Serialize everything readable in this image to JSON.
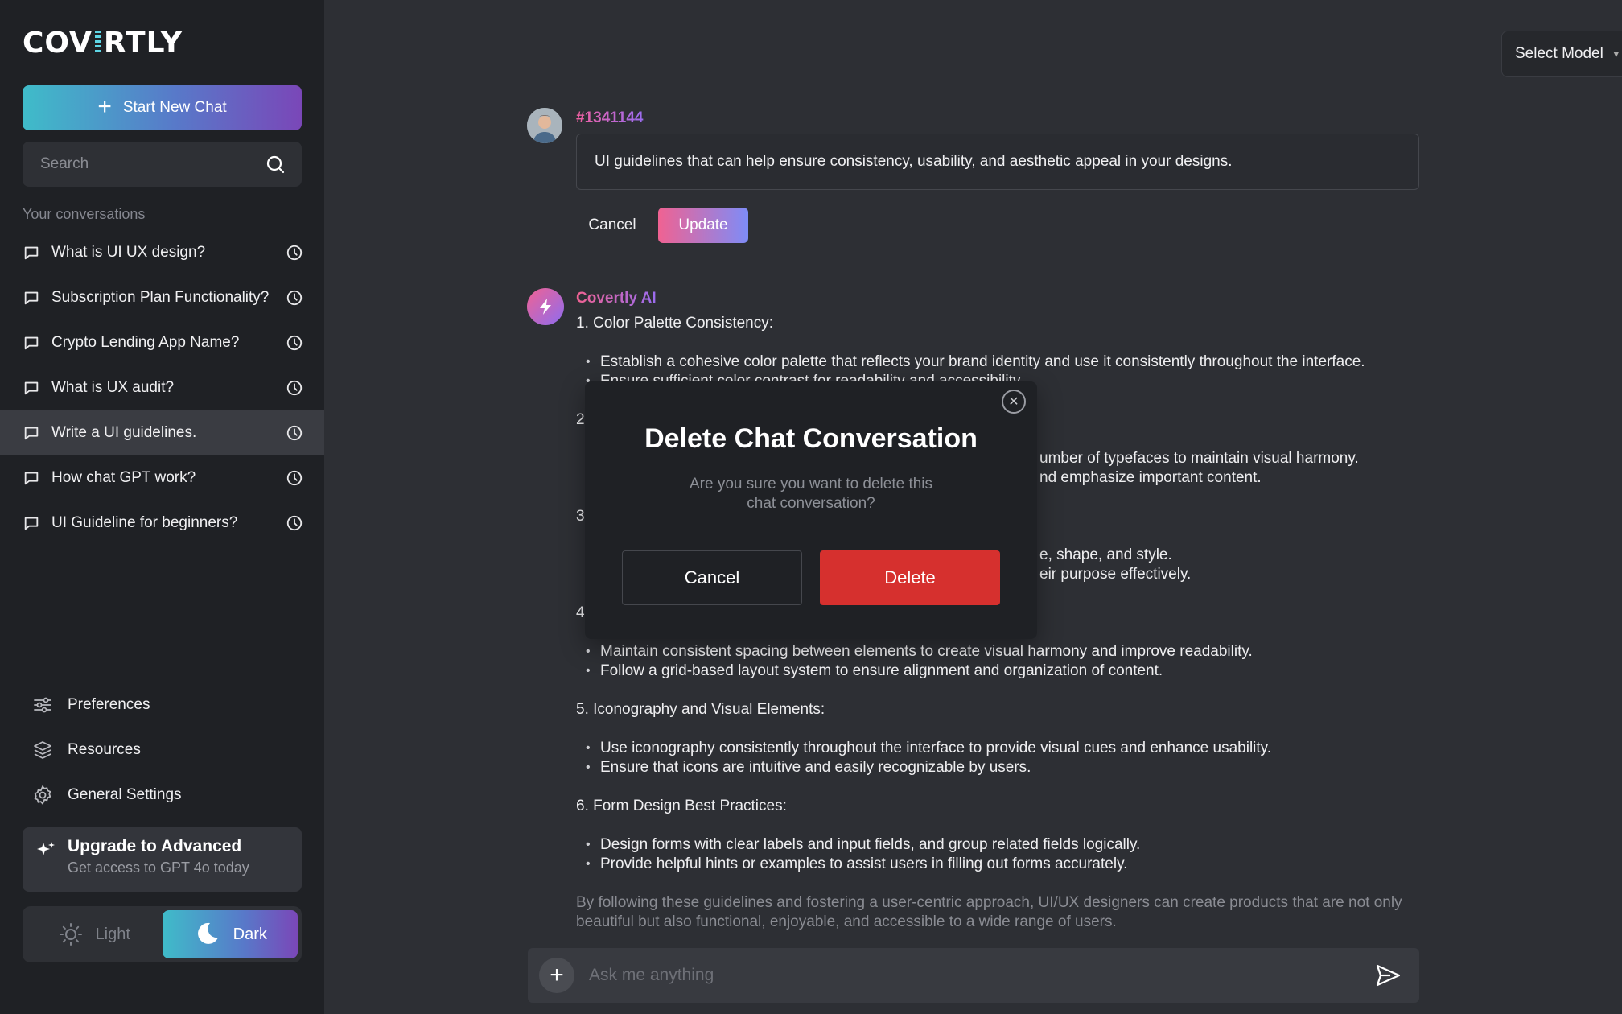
{
  "app": {
    "logo_text_a": "COV",
    "logo_text_b": "RTLY"
  },
  "sidebar": {
    "new_chat_label": "Start New Chat",
    "search_placeholder": "Search",
    "conversations_heading": "Your conversations",
    "conversations": [
      {
        "label": "What is UI UX design?",
        "active": false
      },
      {
        "label": "Subscription Plan Functionality?",
        "active": false
      },
      {
        "label": "Crypto Lending App Name?",
        "active": false
      },
      {
        "label": "What is UX audit?",
        "active": false
      },
      {
        "label": "Write a UI guidelines.",
        "active": true
      },
      {
        "label": "How chat GPT work?",
        "active": false
      },
      {
        "label": "UI Guideline for beginners?",
        "active": false
      }
    ],
    "menu": {
      "preferences": "Preferences",
      "resources": "Resources",
      "general_settings": "General Settings"
    },
    "upgrade": {
      "title": "Upgrade to Advanced",
      "subtitle": "Get access to GPT 4o today"
    },
    "theme": {
      "light_label": "Light",
      "dark_label": "Dark",
      "selected": "Dark"
    }
  },
  "header": {
    "select_model_label": "Select Model"
  },
  "chat": {
    "user_id": "#1341144",
    "edit_text": "UI guidelines that can help ensure consistency, usability, and aesthetic appeal in your designs.",
    "edit_cancel_label": "Cancel",
    "edit_update_label": "Update",
    "ai_name": "Covertly AI",
    "sections": {
      "s1_title": "1. Color Palette Consistency:",
      "s1_b1": "Establish a cohesive color palette that reflects your brand identity and use it consistently throughout the interface.",
      "s1_b2": "Ensure sufficient color contrast for readability and accessibility.",
      "s2_title": "2",
      "s2_b1": "umber of typefaces to maintain visual harmony.",
      "s2_b2": "nd emphasize important content.",
      "s3_title": "3",
      "s3_b1": "e, shape, and style.",
      "s3_b2": "eir purpose effectively.",
      "s4_title": "4",
      "s4_b1": "Maintain consistent spacing between elements to create visual harmony and improve readability.",
      "s4_b2": "Follow a grid-based layout system to ensure alignment and organization of content.",
      "s5_title": "5. Iconography and Visual Elements:",
      "s5_b1": "Use iconography consistently throughout the interface to provide visual cues and enhance usability.",
      "s5_b2": "Ensure that icons are intuitive and easily recognizable by users.",
      "s6_title": "6. Form Design Best Practices:",
      "s6_b1": "Design forms with clear labels and input fields, and group related fields logically.",
      "s6_b2": "Provide helpful hints or examples to assist users in filling out forms accurately.",
      "conclusion": "By following these guidelines and fostering a user-centric approach, UI/UX designers can create products that are not only beautiful but also functional, enjoyable, and accessible to a wide range of users."
    }
  },
  "composer": {
    "placeholder": "Ask me anything"
  },
  "modal": {
    "title": "Delete Chat Conversation",
    "text": "Are you  sure you want to delete this chat conversation?",
    "cancel_label": "Cancel",
    "delete_label": "Delete"
  },
  "colors": {
    "sidebar_bg": "#1f2125",
    "main_bg": "#2d2f34",
    "brand_gradient_start": "#3fbcc9",
    "brand_gradient_end": "#7a47b8",
    "delete_red": "#d6302e",
    "accent_pink": "#f06292"
  }
}
